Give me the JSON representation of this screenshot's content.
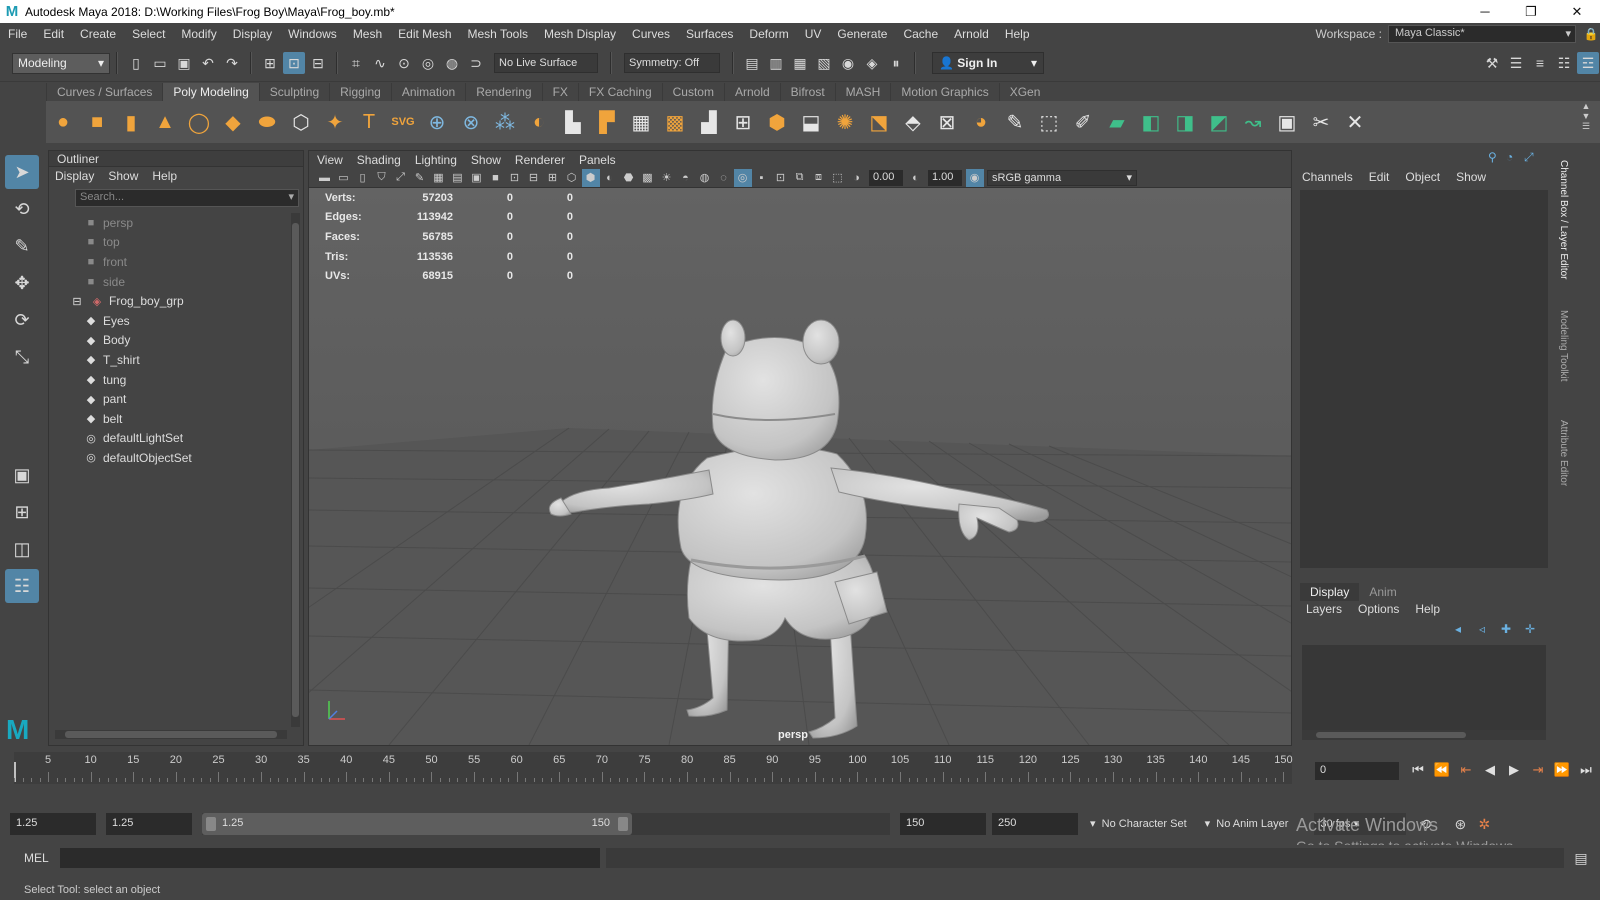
{
  "window": {
    "title": "Autodesk Maya 2018: D:\\Working Files\\Frog Boy\\Maya\\Frog_boy.mb*",
    "controls": [
      "─",
      "❐",
      "✕"
    ]
  },
  "menubar": {
    "items": [
      "File",
      "Edit",
      "Create",
      "Select",
      "Modify",
      "Display",
      "Windows",
      "Mesh",
      "Edit Mesh",
      "Mesh Tools",
      "Mesh Display",
      "Curves",
      "Surfaces",
      "Deform",
      "UV",
      "Generate",
      "Cache",
      "Arnold",
      "Help"
    ],
    "workspace_label": "Workspace :",
    "workspace_value": "Maya Classic*"
  },
  "statusline": {
    "mode": "Modeling",
    "live_surface": "No Live Surface",
    "symmetry": "Symmetry: Off",
    "sign_in": "Sign In"
  },
  "shelf": {
    "tabs": [
      "Curves / Surfaces",
      "Poly Modeling",
      "Sculpting",
      "Rigging",
      "Animation",
      "Rendering",
      "FX",
      "FX Caching",
      "Custom",
      "Arnold",
      "Bifrost",
      "MASH",
      "Motion Graphics",
      "XGen"
    ],
    "active_tab": "Poly Modeling"
  },
  "outliner": {
    "title": "Outliner",
    "menus": [
      "Display",
      "Show",
      "Help"
    ],
    "search_placeholder": "Search...",
    "items": [
      {
        "label": "persp",
        "type": "camera"
      },
      {
        "label": "top",
        "type": "camera"
      },
      {
        "label": "front",
        "type": "camera"
      },
      {
        "label": "side",
        "type": "camera"
      },
      {
        "label": "Frog_boy_grp",
        "type": "group"
      },
      {
        "label": "Eyes",
        "type": "mesh"
      },
      {
        "label": "Body",
        "type": "mesh"
      },
      {
        "label": "T_shirt",
        "type": "mesh"
      },
      {
        "label": "tung",
        "type": "mesh"
      },
      {
        "label": "pant",
        "type": "mesh"
      },
      {
        "label": "belt",
        "type": "mesh"
      },
      {
        "label": "defaultLightSet",
        "type": "set"
      },
      {
        "label": "defaultObjectSet",
        "type": "set"
      }
    ]
  },
  "viewport": {
    "menus": [
      "View",
      "Shading",
      "Lighting",
      "Show",
      "Renderer",
      "Panels"
    ],
    "exposure": "0.00",
    "gamma": "1.00",
    "color_space": "sRGB gamma",
    "camera_label": "persp",
    "hud": [
      {
        "label": "Verts:",
        "value": "57203",
        "sel": "0",
        "comp": "0"
      },
      {
        "label": "Edges:",
        "value": "113942",
        "sel": "0",
        "comp": "0"
      },
      {
        "label": "Faces:",
        "value": "56785",
        "sel": "0",
        "comp": "0"
      },
      {
        "label": "Tris:",
        "value": "113536",
        "sel": "0",
        "comp": "0"
      },
      {
        "label": "UVs:",
        "value": "68915",
        "sel": "0",
        "comp": "0"
      }
    ]
  },
  "channelbox": {
    "menus": [
      "Channels",
      "Edit",
      "Object",
      "Show"
    ],
    "layer_tabs": [
      "Display",
      "Anim"
    ],
    "layer_menus": [
      "Layers",
      "Options",
      "Help"
    ],
    "side_tabs": [
      "Channel Box / Layer Editor",
      "Modeling Toolkit",
      "Attribute Editor"
    ]
  },
  "timeslider": {
    "ticks": [
      5,
      10,
      15,
      20,
      25,
      30,
      35,
      40,
      45,
      50,
      55,
      60,
      65,
      70,
      75,
      80,
      85,
      90,
      95,
      100,
      105,
      110,
      115,
      120,
      125,
      130,
      135,
      140,
      145,
      150
    ],
    "range_start": 1,
    "range_end": 150,
    "current_frame": "0"
  },
  "rangebar": {
    "start_time": "1.25",
    "playback_start": "1.25",
    "slider_start": "1.25",
    "slider_end": "150",
    "playback_end": "150",
    "end_time": "250",
    "character_set": "No Character Set",
    "anim_layer": "No Anim Layer",
    "fps": "30 fps"
  },
  "watermark": {
    "line1": "Activate Windows",
    "line2": "Go to Settings to activate Windows."
  },
  "cmdline": {
    "label": "MEL"
  },
  "helpline": {
    "text": "Select Tool: select an object"
  },
  "colors": {
    "accent": "#5285a6",
    "ui_bg": "#444444",
    "viewport_bg": "#5c5c5c",
    "maya_brand": "#19a9c0"
  }
}
